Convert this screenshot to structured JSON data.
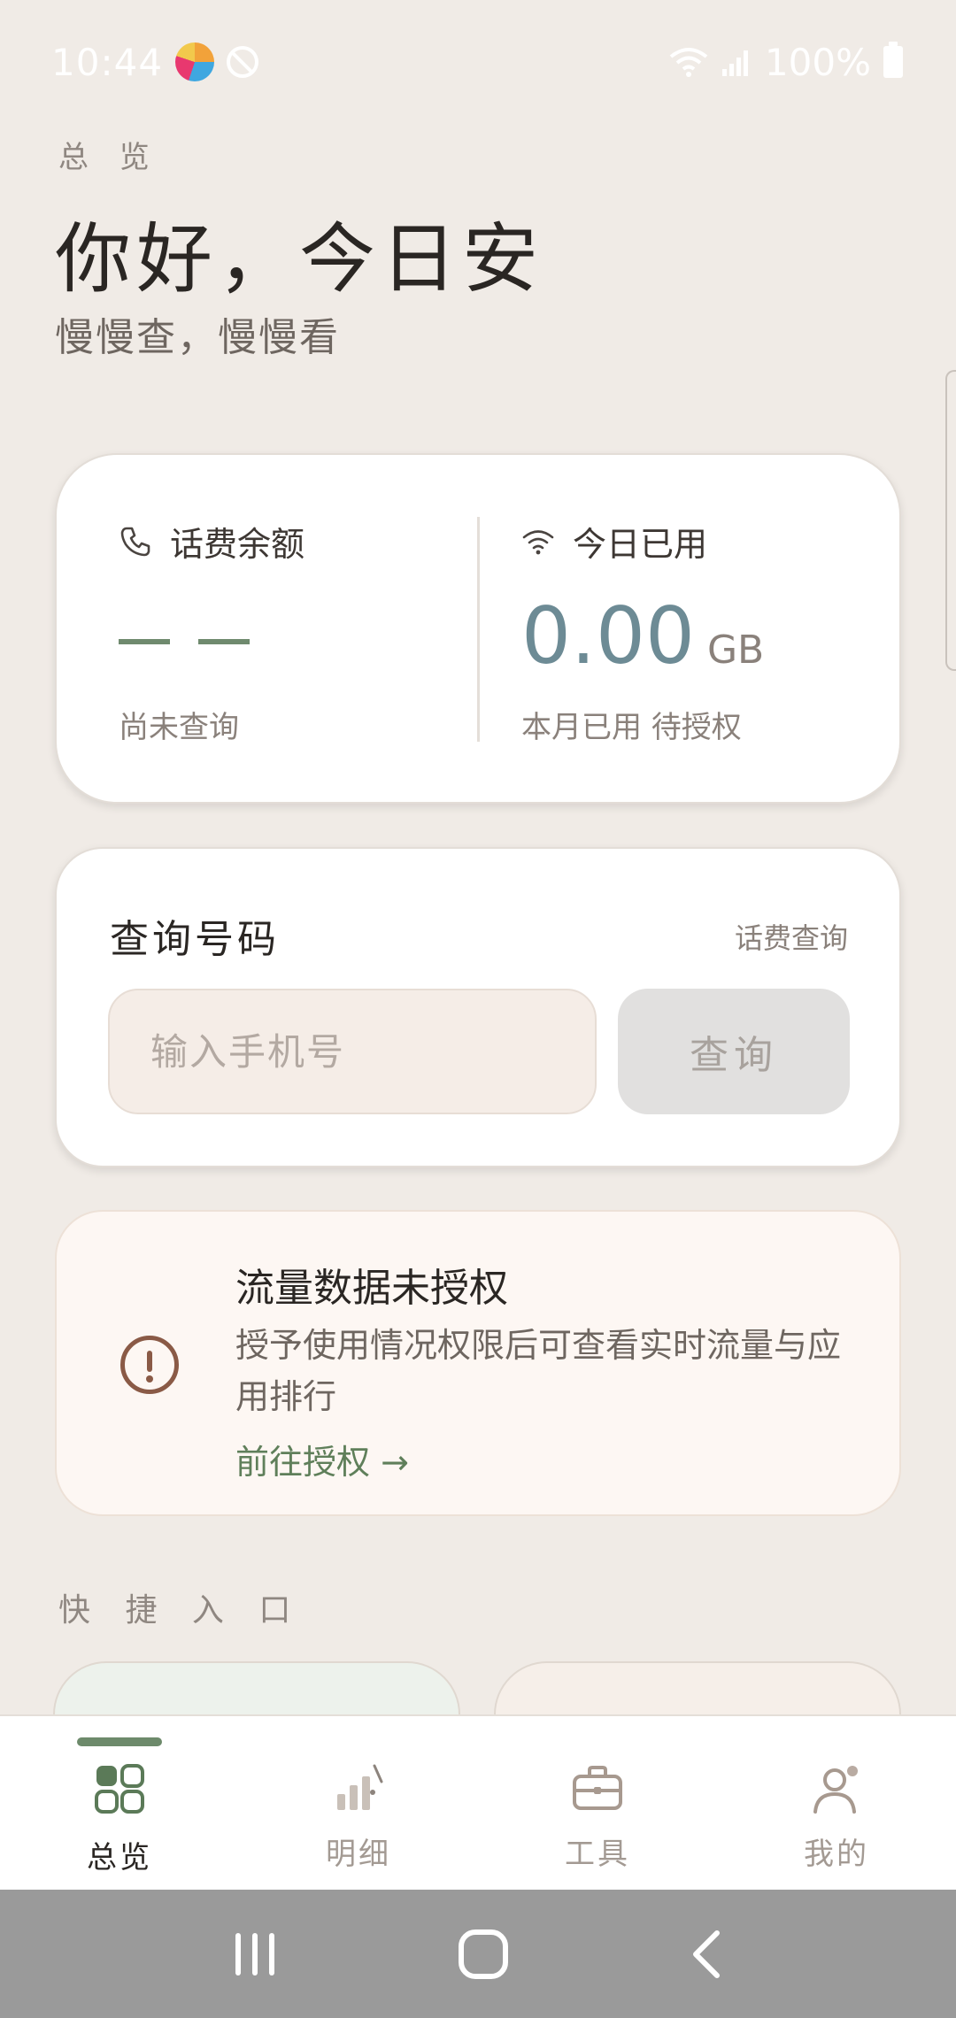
{
  "status_bar": {
    "time": "10:44",
    "battery": "100%"
  },
  "header": {
    "overline": "总 览",
    "greeting": "你好，今日安",
    "subtitle": "慢慢查，慢慢看"
  },
  "balance_card": {
    "left": {
      "label": "话费余额",
      "icon": "phone-icon",
      "value_placeholder": "— —",
      "note": "尚未查询"
    },
    "right": {
      "label": "今日已用",
      "icon": "wifi-icon",
      "value": "0.00",
      "unit": "GB",
      "note": "本月已用 待授权"
    }
  },
  "query_card": {
    "title": "查询号码",
    "link": "话费查询",
    "input_placeholder": "输入手机号",
    "input_value": "",
    "button_label": "查询"
  },
  "notice_card": {
    "title": "流量数据未授权",
    "body": "授予使用情况权限后可查看实时流量与应用排行",
    "action": "前往授权 →",
    "icon": "alert-circle-icon"
  },
  "quick_entries": {
    "label": "快 捷 入 口"
  },
  "bottom_nav": {
    "items": [
      {
        "label": "总览",
        "icon": "grid-icon",
        "active": true
      },
      {
        "label": "明细",
        "icon": "bar-chart-icon",
        "active": false
      },
      {
        "label": "工具",
        "icon": "briefcase-icon",
        "active": false
      },
      {
        "label": "我的",
        "icon": "user-icon",
        "active": false
      }
    ]
  },
  "system_nav": {
    "icons": [
      "recents-icon",
      "home-icon",
      "back-icon"
    ]
  },
  "colors": {
    "background": "#f0ebe6",
    "accent_green": "#6d8a6b",
    "value_blue": "#6d8b95",
    "alert_brown": "#8a5a46"
  }
}
